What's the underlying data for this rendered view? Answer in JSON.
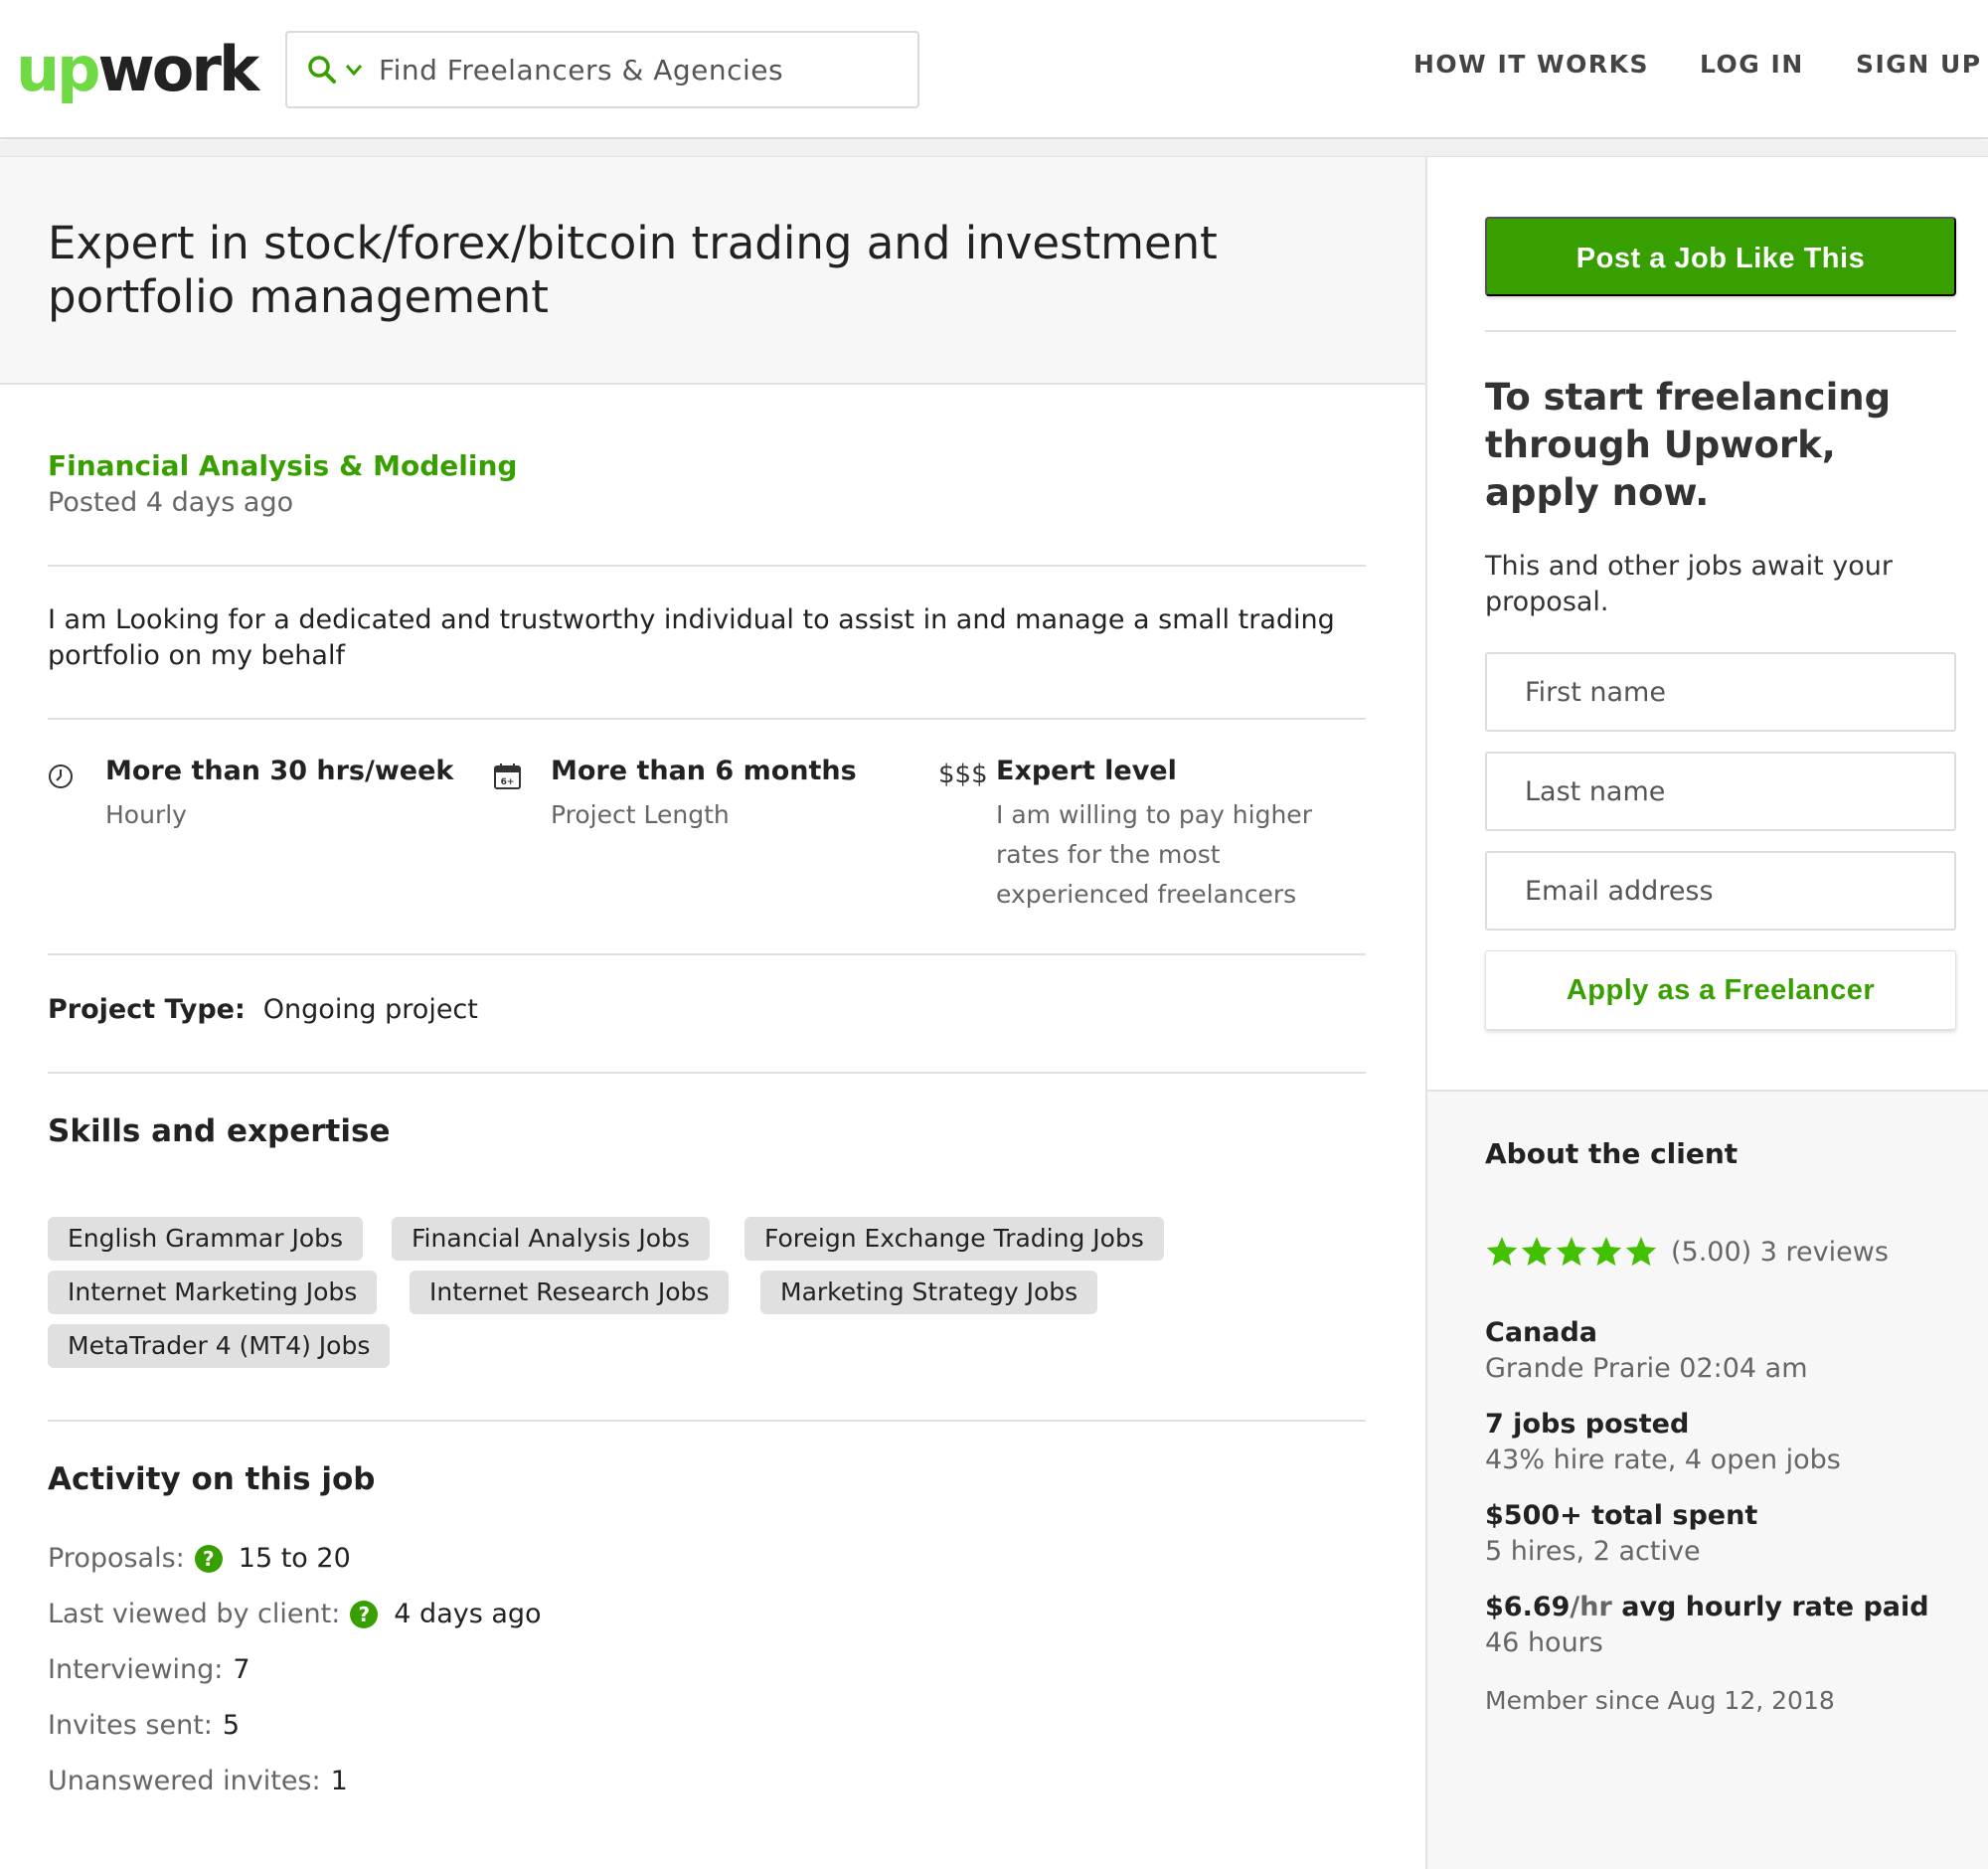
{
  "header": {
    "logo_up": "up",
    "logo_work": "work",
    "search_placeholder": "Find Freelancers & Agencies",
    "nav": [
      "HOW IT WORKS",
      "LOG IN",
      "SIGN UP"
    ]
  },
  "job": {
    "title": "Expert in stock/forex/bitcoin trading and investment portfolio management",
    "category": "Financial Analysis & Modeling",
    "posted": "Posted 4 days ago",
    "description": "I am Looking for a dedicated and trustworthy individual to assist in and manage a small trading portfolio on my behalf",
    "features": [
      {
        "icon": "clock-icon",
        "title": "More than 30 hrs/week",
        "subtitle": "Hourly"
      },
      {
        "icon": "calendar-icon",
        "title": "More than 6 months",
        "subtitle": "Project Length"
      },
      {
        "icon": "$$$",
        "title": "Expert level",
        "subtitle": "I am willing to pay higher rates for the most experienced freelancers"
      }
    ],
    "project_type_label": "Project Type:",
    "project_type_value": "Ongoing project",
    "skills_heading": "Skills and expertise",
    "skills": [
      "English Grammar Jobs",
      "Financial Analysis Jobs",
      "Foreign Exchange Trading Jobs",
      "Internet Marketing Jobs",
      "Internet Research Jobs",
      "Marketing Strategy Jobs",
      "MetaTrader 4 (MT4) Jobs"
    ],
    "activity_heading": "Activity on this job",
    "activity": {
      "proposals_label": "Proposals:",
      "proposals_value": "15 to 20",
      "last_viewed_label": "Last viewed by client:",
      "last_viewed_value": "4 days ago",
      "interviewing_label": "Interviewing:",
      "interviewing_value": "7",
      "invites_label": "Invites sent:",
      "invites_value": "5",
      "unanswered_label": "Unanswered invites:",
      "unanswered_value": "1"
    }
  },
  "sidebar": {
    "post_button": "Post a Job Like This",
    "heading": "To start freelancing through Upwork, apply now.",
    "subheading": "This and other jobs await your proposal.",
    "first_name_placeholder": "First name",
    "last_name_placeholder": "Last name",
    "email_placeholder": "Email address",
    "apply_button": "Apply as a Freelancer"
  },
  "client": {
    "heading": "About the client",
    "rating_stars": 5,
    "rating_text": "(5.00) 3 reviews",
    "country": "Canada",
    "city_time": "Grande Prarie 02:04 am",
    "jobs_posted": "7 jobs posted",
    "hire_rate": "43% hire rate, 4 open jobs",
    "total_spent": "$500+ total spent",
    "hires": "5 hires, 2 active",
    "rate_value": "$6.69",
    "rate_unit": "/hr",
    "rate_label": "avg hourly rate paid",
    "hours": "46 hours",
    "member_since": "Member since Aug 12, 2018"
  },
  "colors": {
    "brand_green": "#37a000",
    "logo_green": "#6fda44",
    "star_green": "#43c000"
  }
}
